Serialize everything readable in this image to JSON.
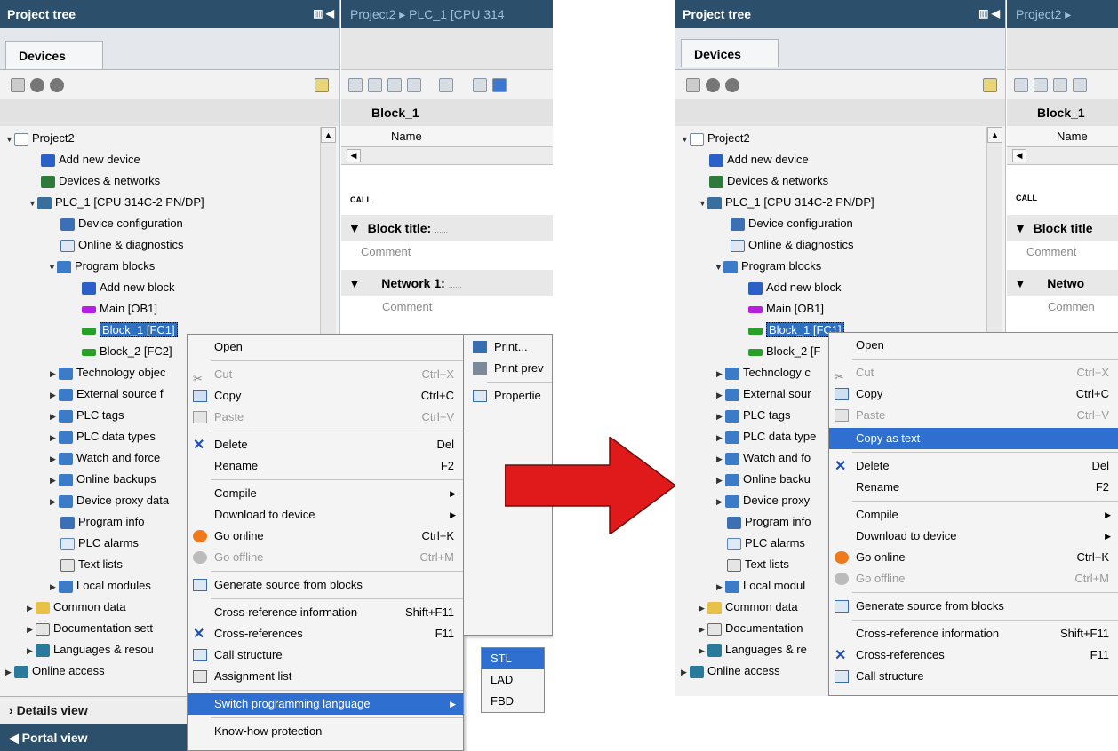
{
  "left": {
    "project_tree_title": "Project tree",
    "devices_tab": "Devices",
    "tree": {
      "project": "Project2",
      "add_new_device": "Add new device",
      "devices_networks": "Devices & networks",
      "plc": "PLC_1 [CPU 314C-2 PN/DP]",
      "device_configuration": "Device configuration",
      "online_diagnostics": "Online & diagnostics",
      "program_blocks": "Program blocks",
      "add_new_block": "Add new block",
      "main_ob1": "Main [OB1]",
      "block1": "Block_1 [FC1]",
      "block2": "Block_2 [FC2]",
      "technology": "Technology objec",
      "external": "External source f",
      "plc_tags": "PLC tags",
      "plc_data_types": "PLC data types",
      "watch_force": "Watch and force",
      "online_backups": "Online backups",
      "device_proxy": "Device proxy data",
      "program_info": "Program info",
      "plc_alarms": "PLC alarms",
      "text_lists": "Text lists",
      "local_modules": "Local modules",
      "common_data": "Common data",
      "documentation": "Documentation sett",
      "languages": "Languages & resou",
      "online_access": "Online access"
    },
    "details_view": "Details view",
    "portal_view": "Portal view",
    "editor": {
      "breadcrumb": "Project2 ▸ PLC_1 [CPU 314",
      "block_name": "Block_1",
      "col_name": "Name",
      "call": "CALL",
      "block_title": "Block title:",
      "block_title_dots": "......",
      "comment": "Comment",
      "network": "Network 1:",
      "network_dots": "......",
      "net_comment": "Comment"
    },
    "menu": {
      "open": "Open",
      "cut": "Cut",
      "cut_sc": "Ctrl+X",
      "copy": "Copy",
      "copy_sc": "Ctrl+C",
      "paste": "Paste",
      "paste_sc": "Ctrl+V",
      "delete": "Delete",
      "delete_sc": "Del",
      "rename": "Rename",
      "rename_sc": "F2",
      "compile": "Compile",
      "download": "Download to device",
      "go_online": "Go online",
      "go_online_sc": "Ctrl+K",
      "go_offline": "Go offline",
      "go_offline_sc": "Ctrl+M",
      "generate_source": "Generate source from blocks",
      "xref_info": "Cross-reference information",
      "xref_info_sc": "Shift+F11",
      "xrefs": "Cross-references",
      "xrefs_sc": "F11",
      "call_structure": "Call structure",
      "assignment_list": "Assignment list",
      "switch_lang": "Switch programming language",
      "knowhow": "Know-how protection"
    },
    "menu2": {
      "print": "Print...",
      "print_preview": "Print prev",
      "properties": "Propertie"
    },
    "submenu": [
      "STL",
      "LAD",
      "FBD"
    ]
  },
  "right": {
    "project_tree_title": "Project tree",
    "devices_tab": "Devices",
    "tree": {
      "project": "Project2",
      "add_new_device": "Add new device",
      "devices_networks": "Devices & networks",
      "plc": "PLC_1 [CPU 314C-2 PN/DP]",
      "device_configuration": "Device configuration",
      "online_diagnostics": "Online & diagnostics",
      "program_blocks": "Program blocks",
      "add_new_block": "Add new block",
      "main_ob1": "Main [OB1]",
      "block1": "Block_1 [FC1]",
      "block2": "Block_2 [F",
      "technology": "Technology c",
      "external": "External sour",
      "plc_tags": "PLC tags",
      "plc_data_types": "PLC data type",
      "watch_force": "Watch and fo",
      "online_backups": "Online backu",
      "device_proxy": "Device proxy",
      "program_info": "Program info",
      "plc_alarms": "PLC alarms",
      "text_lists": "Text lists",
      "local_modules": "Local modul",
      "common_data": "Common data",
      "documentation": "Documentation",
      "languages": "Languages & re",
      "online_access": "Online access"
    },
    "editor": {
      "breadcrumb": "Project2 ▸",
      "block_name": "Block_1",
      "col_name": "Name",
      "call": "CALL",
      "block_title": "Block title",
      "comment": "Comment",
      "network": "Netwo",
      "net_comment": "Commen"
    },
    "menu": {
      "open": "Open",
      "cut": "Cut",
      "cut_sc": "Ctrl+X",
      "copy": "Copy",
      "copy_sc": "Ctrl+C",
      "paste": "Paste",
      "paste_sc": "Ctrl+V",
      "copy_as_text": "Copy as text",
      "delete": "Delete",
      "delete_sc": "Del",
      "rename": "Rename",
      "rename_sc": "F2",
      "compile": "Compile",
      "download": "Download to device",
      "go_online": "Go online",
      "go_online_sc": "Ctrl+K",
      "go_offline": "Go offline",
      "go_offline_sc": "Ctrl+M",
      "generate_source": "Generate source from blocks",
      "xref_info": "Cross-reference information",
      "xref_info_sc": "Shift+F11",
      "xrefs": "Cross-references",
      "xrefs_sc": "F11",
      "call_structure": "Call structure"
    }
  },
  "colors": {
    "header_blue": "#2c4f6b",
    "selection_blue": "#2f6fd0",
    "arrow_red": "#e0191b"
  }
}
